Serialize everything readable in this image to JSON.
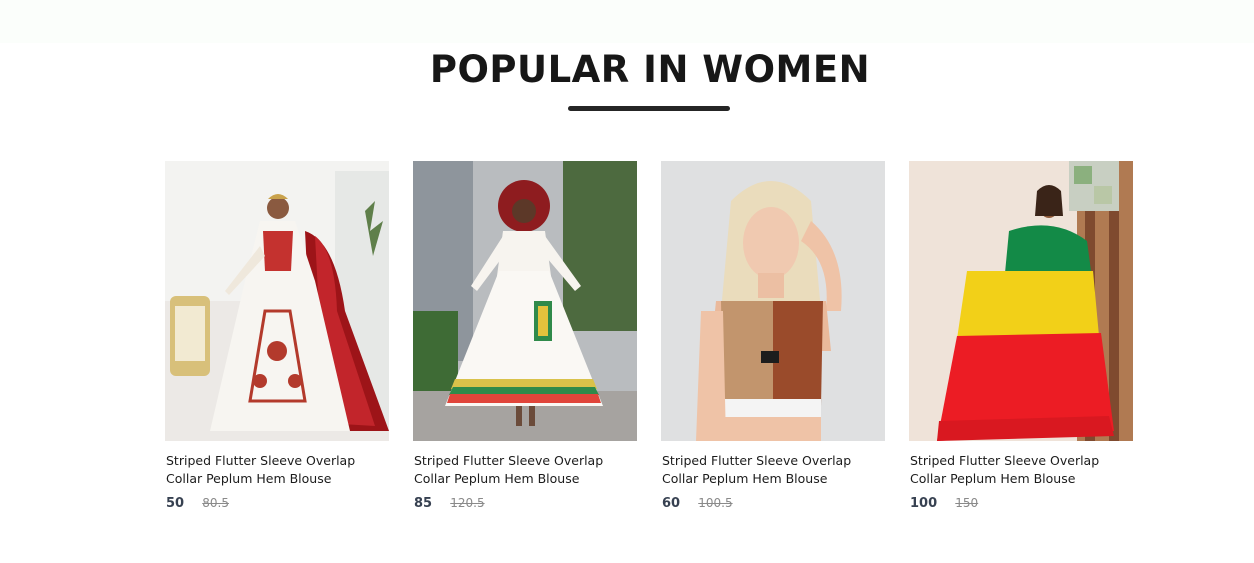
{
  "section": {
    "title": "POPULAR IN WOMEN"
  },
  "products": [
    {
      "name": "Striped Flutter Sleeve Overlap Collar Peplum Hem Blouse",
      "new_price": "50",
      "old_price": "80.5",
      "image": "white embroidered gown with red cape"
    },
    {
      "name": "Striped Flutter Sleeve Overlap Collar Peplum Hem Blouse",
      "new_price": "85",
      "old_price": "120.5",
      "image": "white dress with green yellow red striped hem"
    },
    {
      "name": "Striped Flutter Sleeve Overlap Collar Peplum Hem Blouse",
      "new_price": "60",
      "old_price": "100.5",
      "image": "tan and brown sports crop top"
    },
    {
      "name": "Striped Flutter Sleeve Overlap Collar Peplum Hem Blouse",
      "new_price": "100",
      "old_price": "150",
      "image": "green yellow red flag wrap"
    }
  ]
}
